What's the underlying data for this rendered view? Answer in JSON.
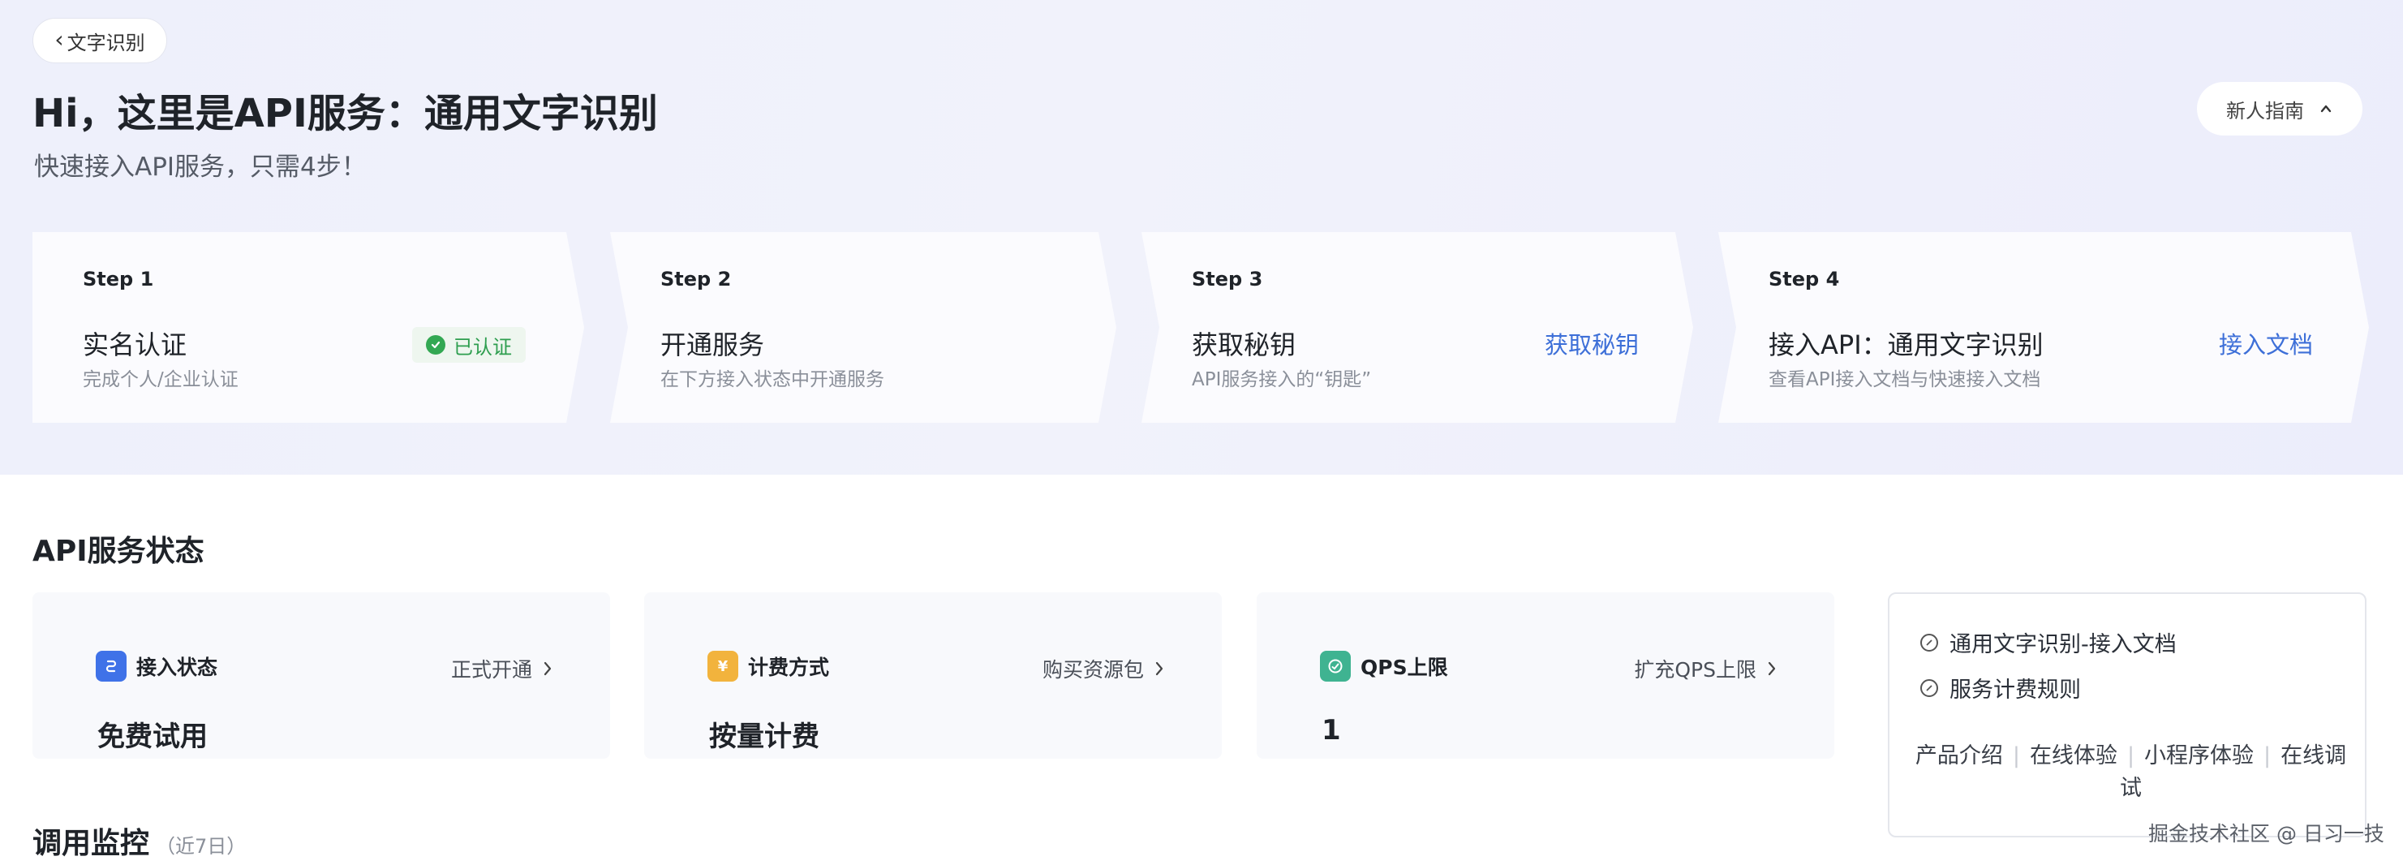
{
  "back_button": {
    "label": "文字识别"
  },
  "hero": {
    "title": "Hi，这里是API服务：通用文字识别",
    "subtitle": "快速接入API服务，只需4步！"
  },
  "guide_button": {
    "label": "新人指南"
  },
  "steps": [
    {
      "number": "Step 1",
      "name": "实名认证",
      "desc": "完成个人/企业认证",
      "badge": "已认证"
    },
    {
      "number": "Step 2",
      "name": "开通服务",
      "desc": "在下方接入状态中开通服务"
    },
    {
      "number": "Step 3",
      "name": "获取秘钥",
      "desc": "API服务接入的“钥匙”",
      "link": "获取秘钥"
    },
    {
      "number": "Step 4",
      "name": "接入API：通用文字识别",
      "desc": "查看API接入文档与快速接入文档",
      "link": "接入文档"
    }
  ],
  "status_section": {
    "title": "API服务状态"
  },
  "cards": [
    {
      "label": "接入状态",
      "action": "正式开通",
      "value": "免费试用",
      "icon_color": "#3f72e8",
      "icon": "link-icon"
    },
    {
      "label": "计费方式",
      "action": "购买资源包",
      "value": "按量计费",
      "icon_color": "#f2b33d",
      "icon": "yen-icon"
    },
    {
      "label": "QPS上限",
      "action": "扩充QPS上限",
      "value": "1",
      "icon_color": "#3fb391",
      "icon": "gauge-icon"
    }
  ],
  "doc_panel": {
    "links": [
      "通用文字识别-接入文档",
      "服务计费规则"
    ],
    "nav": [
      "产品介绍",
      "在线体验",
      "小程序体验",
      "在线调试"
    ]
  },
  "monitor": {
    "title": "调用监控",
    "range": "（近7日）"
  },
  "watermark": "掘金技术社区 @ 日习一技"
}
